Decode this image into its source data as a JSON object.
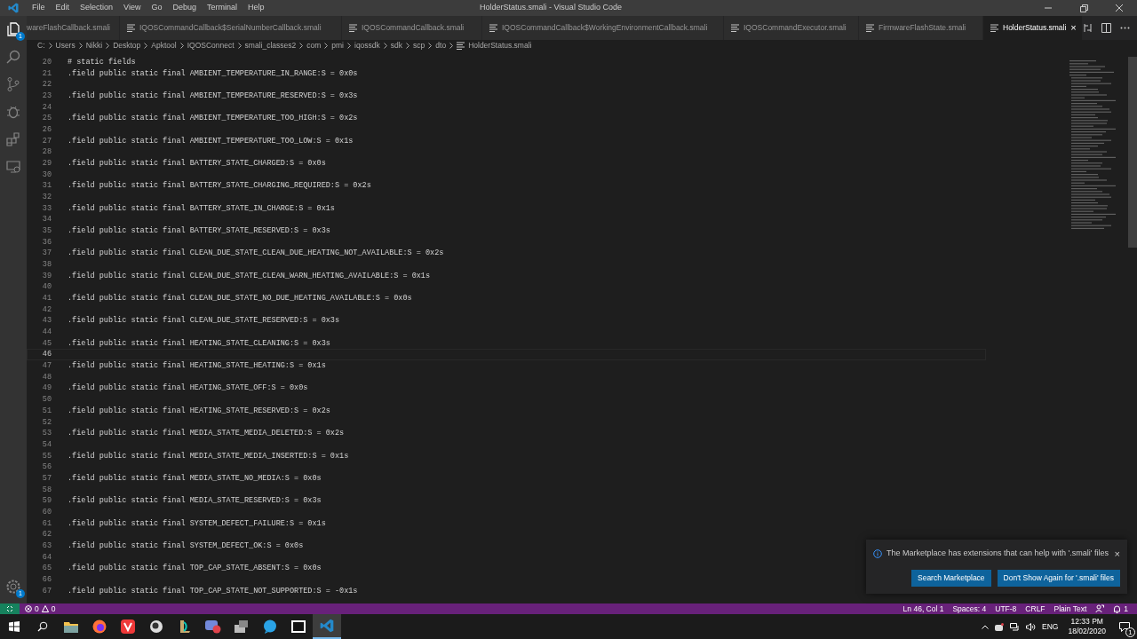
{
  "title_bar": {
    "menu": [
      "File",
      "Edit",
      "Selection",
      "View",
      "Go",
      "Debug",
      "Terminal",
      "Help"
    ],
    "title": "HolderStatus.smali - Visual Studio Code"
  },
  "activity_bar": {
    "explorer_badge": "1",
    "settings_badge": "1"
  },
  "tabs": [
    {
      "label": "wareFlashCallback.smali",
      "selected": false
    },
    {
      "label": "IQOSCommandCallback$SerialNumberCallback.smali",
      "selected": false
    },
    {
      "label": "IQOSCommandCallback.smali",
      "selected": false
    },
    {
      "label": "IQOSCommandCallback$WorkingEnvironmentCallback.smali",
      "selected": false
    },
    {
      "label": "IQOSCommandExecutor.smali",
      "selected": false
    },
    {
      "label": "FirmwareFlashState.smali",
      "selected": false
    },
    {
      "label": "HolderStatus.smali",
      "selected": true,
      "close": "×"
    }
  ],
  "breadcrumb": [
    "C:",
    "Users",
    "Nikki",
    "Desktop",
    "Apktool",
    "IQOSConnect",
    "smali_classes2",
    "com",
    "pmi",
    "iqossdk",
    "sdk",
    "scp",
    "dto",
    "HolderStatus.smali"
  ],
  "editor": {
    "lines": [
      {
        "number": "20",
        "text": "# static fields",
        "current": false
      },
      {
        "number": "21",
        "text": ".field public static final AMBIENT_TEMPERATURE_IN_RANGE:S = 0x0s",
        "current": false
      },
      {
        "number": "22",
        "current": false
      },
      {
        "number": "23",
        "text": ".field public static final AMBIENT_TEMPERATURE_RESERVED:S = 0x3s",
        "current": false
      },
      {
        "number": "24",
        "current": false
      },
      {
        "number": "25",
        "text": ".field public static final AMBIENT_TEMPERATURE_TOO_HIGH:S = 0x2s",
        "current": false
      },
      {
        "number": "26",
        "current": false
      },
      {
        "number": "27",
        "text": ".field public static final AMBIENT_TEMPERATURE_TOO_LOW:S = 0x1s",
        "current": false
      },
      {
        "number": "28",
        "current": false
      },
      {
        "number": "29",
        "text": ".field public static final BATTERY_STATE_CHARGED:S = 0x0s",
        "current": false
      },
      {
        "number": "30",
        "current": false
      },
      {
        "number": "31",
        "text": ".field public static final BATTERY_STATE_CHARGING_REQUIRED:S = 0x2s",
        "current": false
      },
      {
        "number": "32",
        "current": false
      },
      {
        "number": "33",
        "text": ".field public static final BATTERY_STATE_IN_CHARGE:S = 0x1s",
        "current": false
      },
      {
        "number": "34",
        "current": false
      },
      {
        "number": "35",
        "text": ".field public static final BATTERY_STATE_RESERVED:S = 0x3s",
        "current": false
      },
      {
        "number": "36",
        "current": false
      },
      {
        "number": "37",
        "text": ".field public static final CLEAN_DUE_STATE_CLEAN_DUE_HEATING_NOT_AVAILABLE:S = 0x2s",
        "current": false
      },
      {
        "number": "38",
        "current": false
      },
      {
        "number": "39",
        "text": ".field public static final CLEAN_DUE_STATE_CLEAN_WARN_HEATING_AVAILABLE:S = 0x1s",
        "current": false
      },
      {
        "number": "40",
        "current": false
      },
      {
        "number": "41",
        "text": ".field public static final CLEAN_DUE_STATE_NO_DUE_HEATING_AVAILABLE:S = 0x0s",
        "current": false
      },
      {
        "number": "42",
        "current": false
      },
      {
        "number": "43",
        "text": ".field public static final CLEAN_DUE_STATE_RESERVED:S = 0x3s",
        "current": false
      },
      {
        "number": "44",
        "current": false
      },
      {
        "number": "45",
        "text": ".field public static final HEATING_STATE_CLEANING:S = 0x3s",
        "current": false
      },
      {
        "number": "46",
        "current": true
      },
      {
        "number": "47",
        "text": ".field public static final HEATING_STATE_HEATING:S = 0x1s",
        "current": false
      },
      {
        "number": "48",
        "current": false
      },
      {
        "number": "49",
        "text": ".field public static final HEATING_STATE_OFF:S = 0x0s",
        "current": false
      },
      {
        "number": "50",
        "current": false
      },
      {
        "number": "51",
        "text": ".field public static final HEATING_STATE_RESERVED:S = 0x2s",
        "current": false
      },
      {
        "number": "52",
        "current": false
      },
      {
        "number": "53",
        "text": ".field public static final MEDIA_STATE_MEDIA_DELETED:S = 0x2s",
        "current": false
      },
      {
        "number": "54",
        "current": false
      },
      {
        "number": "55",
        "text": ".field public static final MEDIA_STATE_MEDIA_INSERTED:S = 0x1s",
        "current": false
      },
      {
        "number": "56",
        "current": false
      },
      {
        "number": "57",
        "text": ".field public static final MEDIA_STATE_NO_MEDIA:S = 0x0s",
        "current": false
      },
      {
        "number": "58",
        "current": false
      },
      {
        "number": "59",
        "text": ".field public static final MEDIA_STATE_RESERVED:S = 0x3s",
        "current": false
      },
      {
        "number": "60",
        "current": false
      },
      {
        "number": "61",
        "text": ".field public static final SYSTEM_DEFECT_FAILURE:S = 0x1s",
        "current": false
      },
      {
        "number": "62",
        "current": false
      },
      {
        "number": "63",
        "text": ".field public static final SYSTEM_DEFECT_OK:S = 0x0s",
        "current": false
      },
      {
        "number": "64",
        "current": false
      },
      {
        "number": "65",
        "text": ".field public static final TOP_CAP_STATE_ABSENT:S = 0x0s",
        "current": false
      },
      {
        "number": "66",
        "current": false
      },
      {
        "number": "67",
        "text": ".field public static final TOP_CAP_STATE_NOT_SUPPORTED:S = -0x1s",
        "current": false
      }
    ]
  },
  "notification": {
    "message": "The Marketplace has extensions that can help with '.smali' files",
    "close": "×",
    "buttons": [
      "Search Marketplace",
      "Don't Show Again for '.smali' files"
    ]
  },
  "status_bar": {
    "errors": "0",
    "warnings": "0",
    "items": [
      "Ln 46, Col 1",
      "Spaces: 4",
      "UTF-8",
      "CRLF",
      "Plain Text"
    ],
    "notifications": "1"
  },
  "taskbar": {
    "language": "ENG",
    "time": "12:33 PM",
    "date": "18/02/2020",
    "action_center_badge": "1"
  }
}
